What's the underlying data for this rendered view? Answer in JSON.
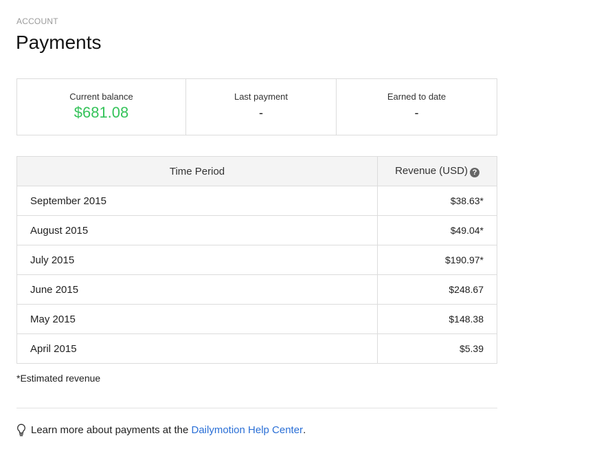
{
  "header": {
    "eyebrow": "ACCOUNT",
    "title": "Payments"
  },
  "stats": {
    "current_balance": {
      "label": "Current balance",
      "value": "$681.08"
    },
    "last_payment": {
      "label": "Last payment",
      "value": "-"
    },
    "earned_to_date": {
      "label": "Earned to date",
      "value": "-"
    }
  },
  "table": {
    "col_period": "Time Period",
    "col_revenue": "Revenue (USD)",
    "rows": [
      {
        "period": "September 2015",
        "revenue": "$38.63*"
      },
      {
        "period": "August 2015",
        "revenue": "$49.04*"
      },
      {
        "period": "July 2015",
        "revenue": "$190.97*"
      },
      {
        "period": "June 2015",
        "revenue": "$248.67"
      },
      {
        "period": "May 2015",
        "revenue": "$148.38"
      },
      {
        "period": "April 2015",
        "revenue": "$5.39"
      }
    ]
  },
  "footnote": "*Estimated revenue",
  "learn_more": {
    "prefix": "Learn more about payments at the ",
    "link": "Dailymotion Help Center",
    "suffix": "."
  },
  "colors": {
    "balance_green": "#35c35a",
    "link_blue": "#2a6fd6"
  }
}
